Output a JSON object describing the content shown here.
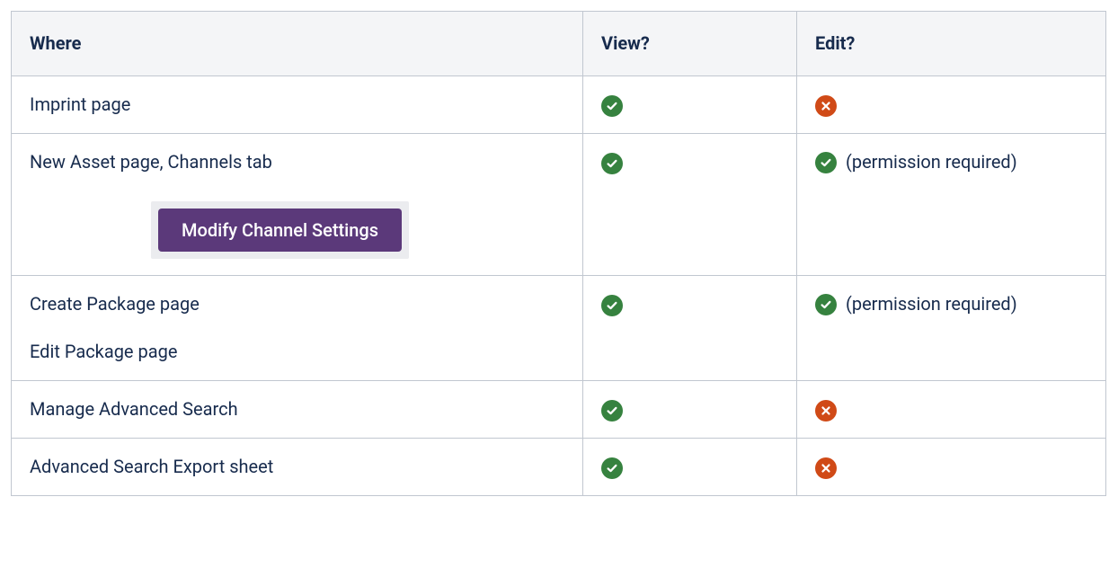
{
  "headers": {
    "where": "Where",
    "view": "View?",
    "edit": "Edit?"
  },
  "perm_note": "(permission required)",
  "modify_button_label": "Modify Channel Settings",
  "rows": [
    {
      "where_lines": [
        "Imprint page"
      ],
      "has_button": false,
      "view": "yes",
      "edit": "no",
      "edit_note": ""
    },
    {
      "where_lines": [
        "New Asset page, Channels tab"
      ],
      "has_button": true,
      "view": "yes",
      "edit": "yes",
      "edit_note": "(permission required)"
    },
    {
      "where_lines": [
        "Create Package page",
        "Edit Package page"
      ],
      "has_button": false,
      "view": "yes",
      "edit": "yes",
      "edit_note": "(permission required)"
    },
    {
      "where_lines": [
        "Manage Advanced Search"
      ],
      "has_button": false,
      "view": "yes",
      "edit": "no",
      "edit_note": ""
    },
    {
      "where_lines": [
        "Advanced Search Export sheet"
      ],
      "has_button": false,
      "view": "yes",
      "edit": "no",
      "edit_note": ""
    }
  ]
}
